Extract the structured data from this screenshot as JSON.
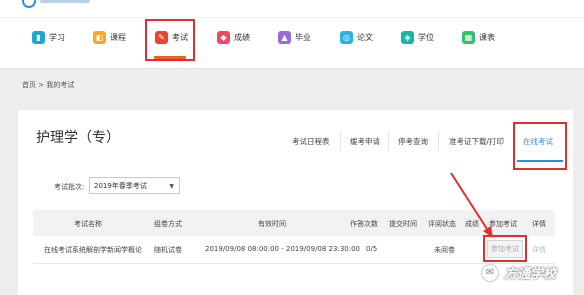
{
  "nav": {
    "items": [
      {
        "label": "学习",
        "icon": "book-icon",
        "color": "#1ea7d6"
      },
      {
        "label": "课程",
        "icon": "course-icon",
        "color": "#f4a92a"
      },
      {
        "label": "考试",
        "icon": "pen-icon",
        "color": "#e8442e"
      },
      {
        "label": "成绩",
        "icon": "grade-icon",
        "color": "#ec4b63"
      },
      {
        "label": "毕业",
        "icon": "graduation-cap-icon",
        "color": "#9a6bd8"
      },
      {
        "label": "论文",
        "icon": "paper-icon",
        "color": "#2bb2e8"
      },
      {
        "label": "学位",
        "icon": "degree-icon",
        "color": "#18b6a8"
      },
      {
        "label": "课表",
        "icon": "calendar-icon",
        "color": "#35c06b"
      }
    ],
    "active": "考试"
  },
  "breadcrumb": "首页 > 我的考试",
  "page": {
    "title": "护理学（专）"
  },
  "tabs": [
    {
      "label": "考试日程表"
    },
    {
      "label": "缓考申请"
    },
    {
      "label": "停考查询"
    },
    {
      "label": "准考证下载/打印"
    },
    {
      "label": "在线考试",
      "active": true
    }
  ],
  "filter": {
    "label": "考试批次:",
    "selected": "2019年春季考试"
  },
  "table": {
    "headers": [
      "考试名称",
      "组卷方式",
      "有效时间",
      "作答次数",
      "提交时间",
      "评阅状态",
      "成绩",
      "参加考试",
      "详情"
    ],
    "rows": [
      [
        "在线考试系统解剖学新闻学概论",
        "随机试卷",
        "2019/09/08 08:00:00 - 2019/09/08 23:30:00",
        "0/5",
        "",
        "未阅卷",
        "",
        "参加考试",
        "详情"
      ]
    ]
  },
  "watermark": "方通学校",
  "colors": {
    "accent": "#2f8fd6",
    "highlight": "#e02f2f",
    "nav_underline": "#e8622a"
  }
}
